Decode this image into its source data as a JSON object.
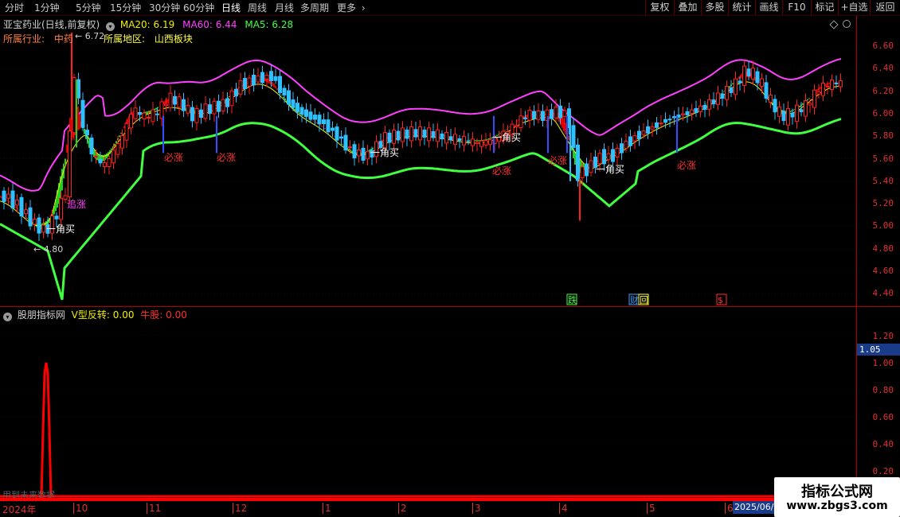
{
  "toolbar": {
    "periods": [
      "分时",
      "1分钟",
      "5分钟",
      "15分钟",
      "30分钟",
      "60分钟",
      "日线",
      "周线",
      "月线",
      "多周期",
      "更多"
    ],
    "active_period": "日线",
    "more_arrow": "›",
    "right_buttons": [
      "复权",
      "叠加",
      "多股",
      "统计",
      "画线",
      "F10",
      "标记",
      "+自选",
      "返回"
    ]
  },
  "main_chart": {
    "title": "亚宝药业(日线,前复权)",
    "ma_labels": [
      {
        "text": "MA20: 6.19",
        "color": "#f0f000"
      },
      {
        "text": "MA60: 6.44",
        "color": "#ff40ff"
      },
      {
        "text": "MA5: 6.28",
        "color": "#40ff40"
      }
    ],
    "industry_label": "所属行业:",
    "industry_value": "中药",
    "region_label": "所属地区:",
    "region_value": "山西板块",
    "price_axis": [
      "6.60",
      "6.40",
      "6.20",
      "6.00",
      "5.80",
      "5.60",
      "5.40",
      "5.20",
      "5.00",
      "4.80",
      "4.60",
      "4.40"
    ],
    "high_marker": "6.72",
    "low_marker": "4.80",
    "signals": [
      {
        "text": "一角买",
        "color": "#ffffff"
      },
      {
        "text": "追涨",
        "color": "#ff40ff"
      },
      {
        "text": "必涨",
        "color": "#ff3030"
      },
      {
        "text": "必涨",
        "color": "#ff3030"
      },
      {
        "text": "一角买",
        "color": "#ffffff"
      },
      {
        "text": "一角买",
        "color": "#ffffff"
      },
      {
        "text": "必涨",
        "color": "#ff3030"
      },
      {
        "text": "必涨",
        "color": "#ff3030"
      },
      {
        "text": "一角买",
        "color": "#ffffff"
      },
      {
        "text": "必涨",
        "color": "#ff3030"
      }
    ],
    "event_badges": [
      {
        "text": "跌",
        "color": "#40ff40"
      },
      {
        "text": "财",
        "color": "#40a0ff"
      },
      {
        "text": "回",
        "color": "#ffff40"
      },
      {
        "text": "$",
        "color": "#ff3030"
      }
    ],
    "colors": {
      "up_candle": "#ff2020",
      "down_candle": "#30c0ff",
      "upper_band": "#ff40ff",
      "lower_band": "#40ff40",
      "ma_line": "#f0f000",
      "ribbon_up": "#e00000",
      "ribbon_down": "#20d020"
    }
  },
  "sub_chart": {
    "title": "股朋指标网",
    "v_reverse_label": "V型反转: 0.00",
    "bull_label": "牛股: 0.00",
    "axis": [
      "1.20",
      "1.00",
      "0.80",
      "0.60",
      "0.40",
      "0.20"
    ],
    "current_value": "1.05",
    "truncated_note": "用到未来数据"
  },
  "time_axis": {
    "labels": [
      "2024年",
      "10",
      "11",
      "12",
      "1",
      "2",
      "3",
      "4",
      "5",
      "6"
    ],
    "current_date": "2025/06/"
  },
  "watermark": {
    "title": "指标公式网",
    "url": "www.zbgs3.com"
  }
}
